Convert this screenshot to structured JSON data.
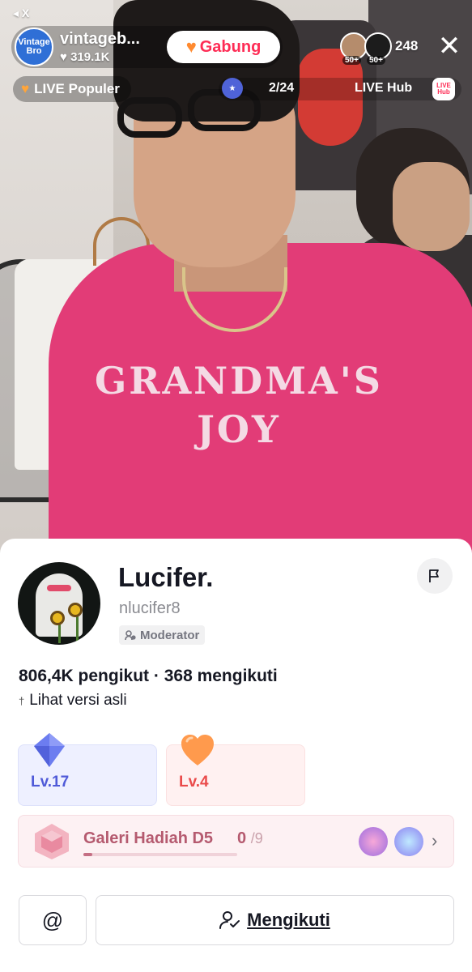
{
  "stream": {
    "back_label": "◂ X",
    "host": {
      "name": "vintageb...",
      "likes": "319.1K",
      "avatar_text": "Vintage Bro"
    },
    "join_label": "Gabung",
    "viewers": [
      {
        "badge": "50+"
      },
      {
        "badge": "50+"
      }
    ],
    "viewer_count": "248",
    "popular_label": "LIVE Populer",
    "rank": "2/24",
    "livehub_label": "LIVE Hub",
    "livehub_icon_text": "LIVE Hub",
    "shirt_print": "GRANDMA'S JOY"
  },
  "profile": {
    "name": "Lucifer.",
    "handle": "nlucifer8",
    "role_badge": "Moderator",
    "stats": "806,4K pengikut · 368 mengikuti",
    "translate_label": "Lihat versi asli"
  },
  "levels": [
    {
      "label": "Lv.17",
      "color": "#4f5ad8"
    },
    {
      "label": "Lv.4",
      "color": "#ea4b4b"
    }
  ],
  "gallery": {
    "label": "Galeri Hadiah D5",
    "collected": "0",
    "total": "/9",
    "progress": 0.06
  },
  "actions": {
    "mention_label": "@",
    "follow_label": "Mengikuti"
  },
  "colors": {
    "accent": "#fe2c55",
    "shirt": "#e23c77"
  }
}
